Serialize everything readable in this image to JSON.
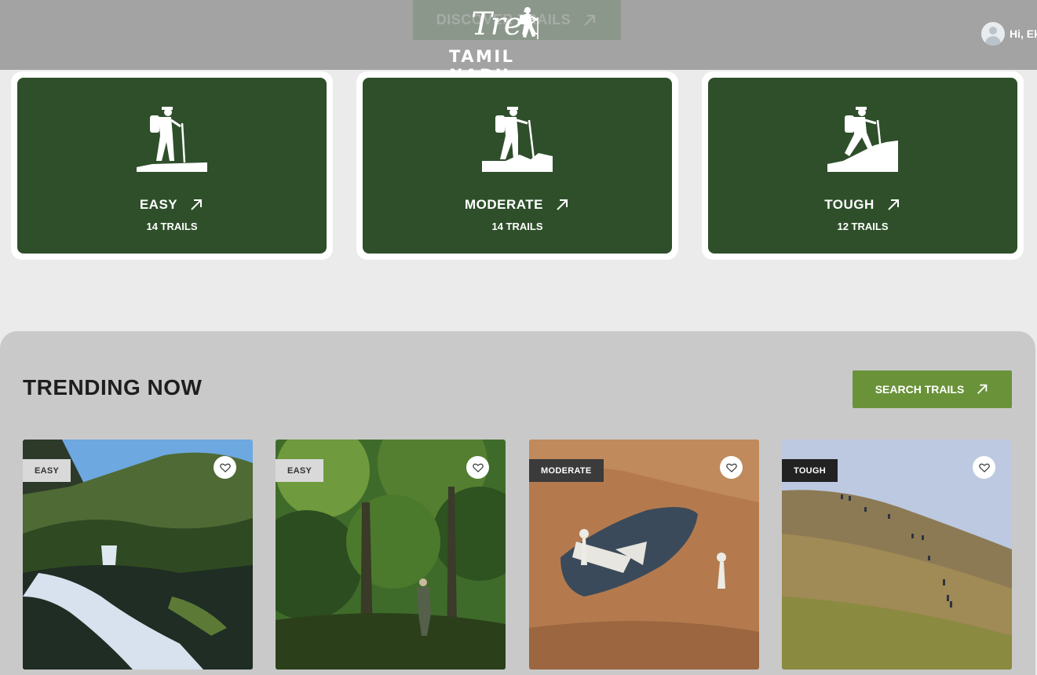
{
  "header": {
    "discover_label": "DISCOVER TRAILS",
    "logo_script": "Trek",
    "logo_sub": "TAMIL NADU",
    "user_greeting": "Hi, Ek"
  },
  "difficulty": [
    {
      "title": "EASY",
      "count": "14 TRAILS"
    },
    {
      "title": "MODERATE",
      "count": "14 TRAILS"
    },
    {
      "title": "TOUGH",
      "count": "12 TRAILS"
    }
  ],
  "trending": {
    "title": "TRENDING NOW",
    "search_label": "SEARCH TRAILS",
    "cards": [
      {
        "badge": "EASY",
        "scene": "waterfall"
      },
      {
        "badge": "EASY",
        "scene": "forest"
      },
      {
        "badge": "MODERATE",
        "scene": "rock-art"
      },
      {
        "badge": "TOUGH",
        "scene": "hill-slope"
      }
    ]
  },
  "colors": {
    "card_green": "#2e4f2a",
    "button_green": "#6a9239",
    "section_bg": "#c9c9c9"
  }
}
